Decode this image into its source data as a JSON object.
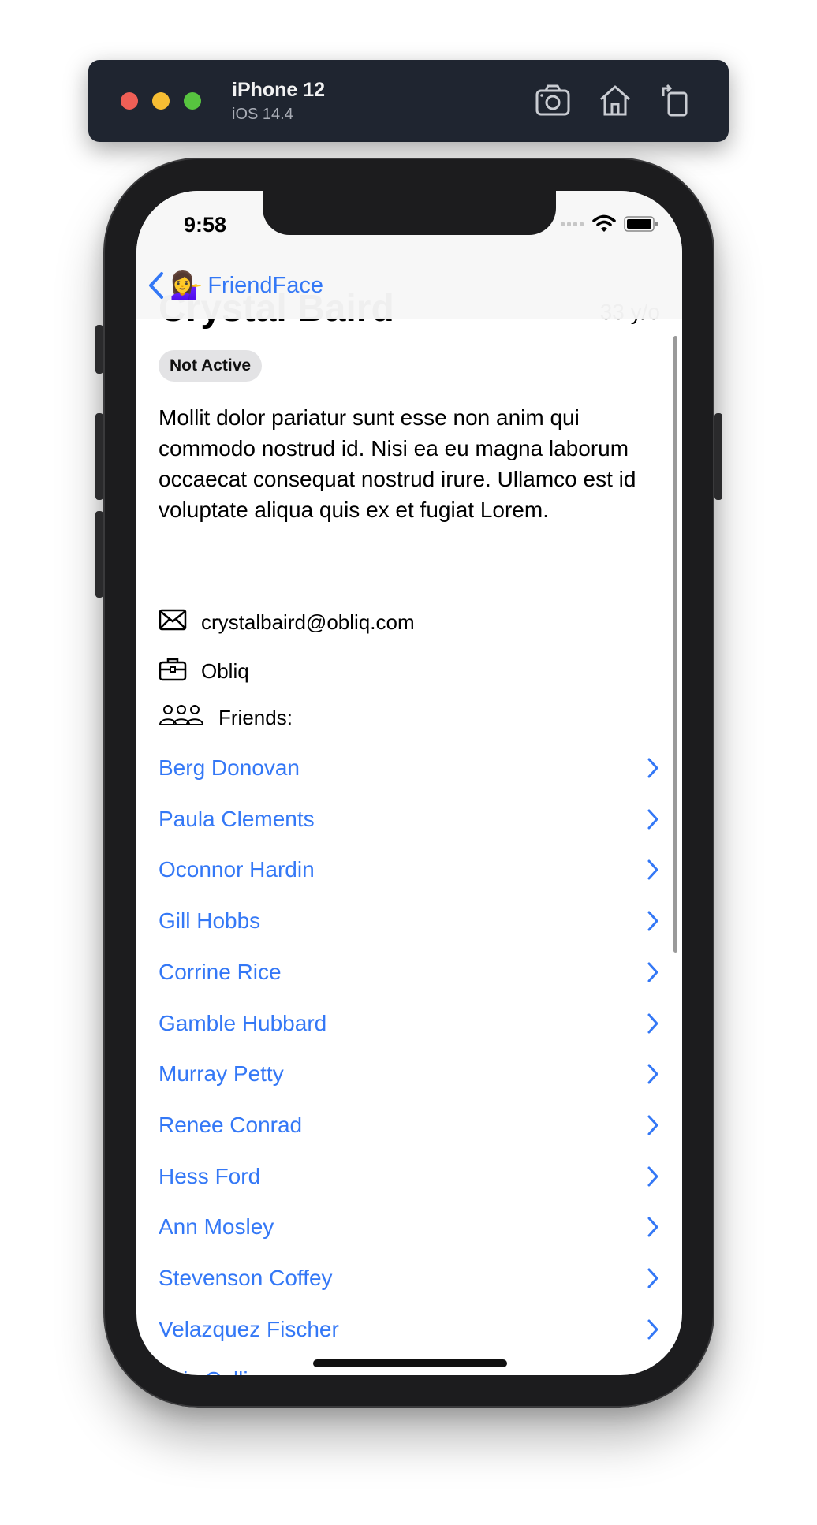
{
  "simulator": {
    "device": "iPhone 12",
    "os": "iOS 14.4",
    "icons": [
      "screenshot-icon",
      "home-icon",
      "rotate-icon"
    ]
  },
  "status_bar": {
    "time": "9:58"
  },
  "nav": {
    "back_emoji": "💁‍♀️",
    "back_label": "FriendFace"
  },
  "profile": {
    "name": "Crystal Baird",
    "age": "33 y/o",
    "status": "Not Active",
    "about": "Mollit dolor pariatur sunt esse non anim qui commodo nostrud id. Nisi ea eu magna laborum occaecat consequat nostrud irure. Ullamco est id voluptate aliqua quis ex et fugiat Lorem.",
    "email": "crystalbaird@obliq.com",
    "company": "Obliq",
    "friends_label": "Friends:"
  },
  "friends": [
    "Berg Donovan",
    "Paula Clements",
    "Oconnor Hardin",
    "Gill Hobbs",
    "Corrine Rice",
    "Gamble Hubbard",
    "Murray Petty",
    "Renee Conrad",
    "Hess Ford",
    "Ann Mosley",
    "Stevenson Coffey",
    "Velazquez Fischer",
    "Lois Collins"
  ],
  "colors": {
    "accent": "#3478f6",
    "toolbar": "#1f2530",
    "badge": "#e3e3e5"
  }
}
